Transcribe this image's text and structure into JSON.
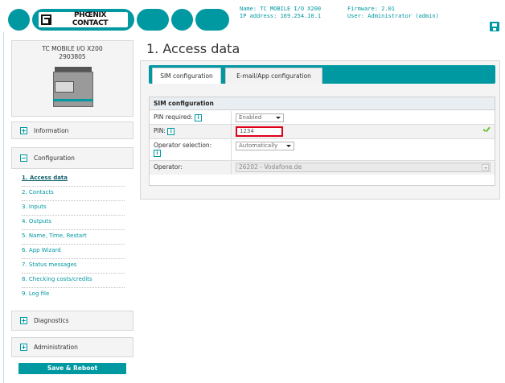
{
  "header": {
    "logo_line1": "PHŒNIX",
    "logo_line2": "CONTACT",
    "name_line": "Name: TC MOBILE I/O X200",
    "ip_line": "IP address: 169.254.10.1",
    "firmware_line": "Firmware: 2.01",
    "user_line": "User: Administrator (admin)",
    "brand_color": "#0098a1",
    "save_icon": "save-icon"
  },
  "device": {
    "model": "TC MOBILE I/O X200",
    "article": "2903805"
  },
  "sidebar": {
    "information": "Information",
    "configuration": "Configuration",
    "config_items": [
      "1. Access data",
      "2. Contacts",
      "3. Inputs",
      "4. Outputs",
      "5. Name, Time, Restart",
      "6. App Wizard",
      "7. Status messages",
      "8. Checking costs/credits",
      "9. Log file"
    ],
    "diagnostics": "Diagnostics",
    "administration": "Administration",
    "save_reboot": "Save & Reboot"
  },
  "main": {
    "title": "1. Access data",
    "tabs": [
      "SIM configuration",
      "E-mail/App configuration"
    ],
    "section_title": "SIM configuration",
    "rows": {
      "pin_required_label": "PIN required:",
      "pin_required_value": "Enabled",
      "pin_label": "PIN:",
      "pin_value": "1234",
      "operator_selection_label": "Operator selection:",
      "operator_selection_value": "Automatically",
      "operator_label": "Operator:",
      "operator_value": "26202 - Vodafone.de"
    },
    "info_glyph": "i",
    "error_outline_color": "#e0001a",
    "valid_color": "#6fbf3a"
  }
}
